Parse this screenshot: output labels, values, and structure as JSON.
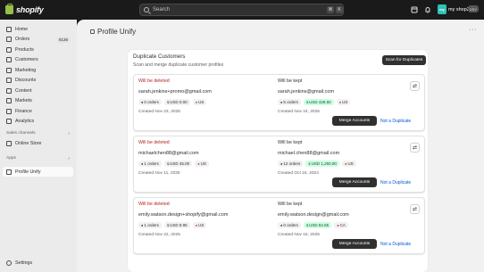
{
  "topbar": {
    "brand": "shopify",
    "search_placeholder": "Search",
    "shortcut_keys": [
      "⌘",
      "K"
    ],
    "store_initials": "my",
    "store_name": "my shop2",
    "user_initials": "DSY"
  },
  "sidebar": {
    "items": [
      {
        "label": "Home",
        "icon": "home-icon"
      },
      {
        "label": "Orders",
        "icon": "orders-icon",
        "badge": "8136"
      },
      {
        "label": "Products",
        "icon": "products-icon"
      },
      {
        "label": "Customers",
        "icon": "customers-icon"
      },
      {
        "label": "Marketing",
        "icon": "marketing-icon"
      },
      {
        "label": "Discounts",
        "icon": "discounts-icon"
      },
      {
        "label": "Content",
        "icon": "content-icon"
      },
      {
        "label": "Markets",
        "icon": "markets-icon"
      },
      {
        "label": "Finance",
        "icon": "finance-icon"
      },
      {
        "label": "Analytics",
        "icon": "analytics-icon"
      }
    ],
    "sales_channels_label": "Sales channels",
    "online_store": "Online Store",
    "apps_label": "Apps",
    "app_item": "Profile Unify",
    "settings": "Settings"
  },
  "page": {
    "title": "Profile Unify"
  },
  "card": {
    "title": "Duplicate Customers",
    "subtitle": "Scan and merge duplicate customer profiles",
    "scan_button": "Scan for Duplicates",
    "delete_label": "Will be deleted",
    "kept_label": "Will be kept",
    "merge_button": "Merge Accounts",
    "not_duplicate": "Not a Duplicate"
  },
  "pairs": [
    {
      "deleted": {
        "email": "sarah.jenkins+promo@gmail.com",
        "orders": "0 orders",
        "spent": "USD 0.00",
        "country": "US",
        "created": "Created Nov 23, 2025"
      },
      "kept": {
        "email": "sarah.jenkins@gmail.com",
        "orders": "5 orders",
        "spent": "USD 428.50",
        "country": "US",
        "created": "Created Nov 24, 2025"
      }
    },
    {
      "deleted": {
        "email": "michaelchen88@gmail.com",
        "orders": "1 orders",
        "spent": "USD 45.00",
        "country": "US",
        "created": "Created Nov 11, 2025"
      },
      "kept": {
        "email": "michael.chen88@gmail.com",
        "orders": "12 orders",
        "spent": "USD 1,250.00",
        "country": "US",
        "created": "Created Oct 24, 2024"
      }
    },
    {
      "deleted": {
        "email": "emily.watson.design+shopify@gmail.com",
        "orders": "1 orders",
        "spent": "USD 8.95",
        "country": "US",
        "created": "Created Nov 22, 2025"
      },
      "kept": {
        "email": "emily.watson.design@gmail.com",
        "orders": "0 orders",
        "spent": "USD 84.65",
        "country": "CA",
        "created": "Created Nov 15, 2025"
      }
    }
  ],
  "colors": {
    "delete": "#b3261e",
    "link": "#005bd3",
    "green_chip": "#cdfee1",
    "brand": "#95bf47"
  }
}
